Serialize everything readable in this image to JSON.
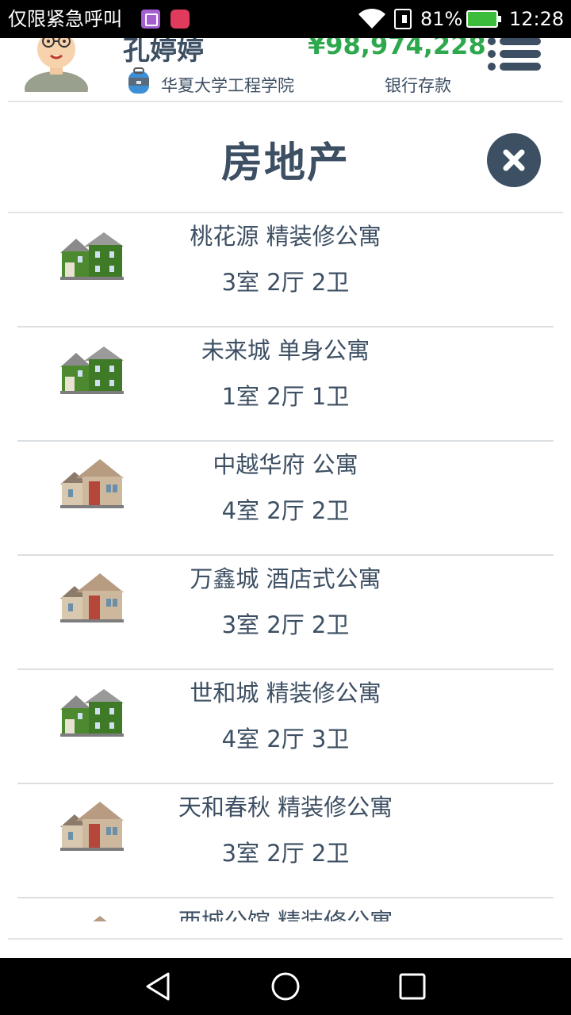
{
  "status_bar": {
    "carrier_text": "仅限紧急呼叫",
    "battery_percent": "81%",
    "time": "12:28"
  },
  "profile": {
    "name": "孔婷婷",
    "money": "¥98,974,228",
    "school": "华夏大学工程学院",
    "money_label": "银行存款"
  },
  "dialog": {
    "title": "房地产"
  },
  "properties": [
    {
      "name": "桃花源 精装修公寓",
      "rooms": "3室 2厅 2卫",
      "icon": "green-house-icon"
    },
    {
      "name": "未来城 单身公寓",
      "rooms": "1室 2厅 1卫",
      "icon": "green-house-icon"
    },
    {
      "name": "中越华府 公寓",
      "rooms": "4室 2厅 2卫",
      "icon": "brown-house-icon"
    },
    {
      "name": "万鑫城 酒店式公寓",
      "rooms": "3室 2厅 2卫",
      "icon": "brown-house-icon"
    },
    {
      "name": "世和城 精装修公寓",
      "rooms": "4室 2厅 3卫",
      "icon": "green-house-icon"
    },
    {
      "name": "天和春秋 精装修公寓",
      "rooms": "3室 2厅 2卫",
      "icon": "brown-house-icon"
    },
    {
      "name": "西城公馆 精装修公寓",
      "rooms": "",
      "icon": "brown-house-icon"
    }
  ],
  "colors": {
    "text": "#3d4f63",
    "money": "#2ea84d",
    "close_bg": "#3d4f63"
  }
}
